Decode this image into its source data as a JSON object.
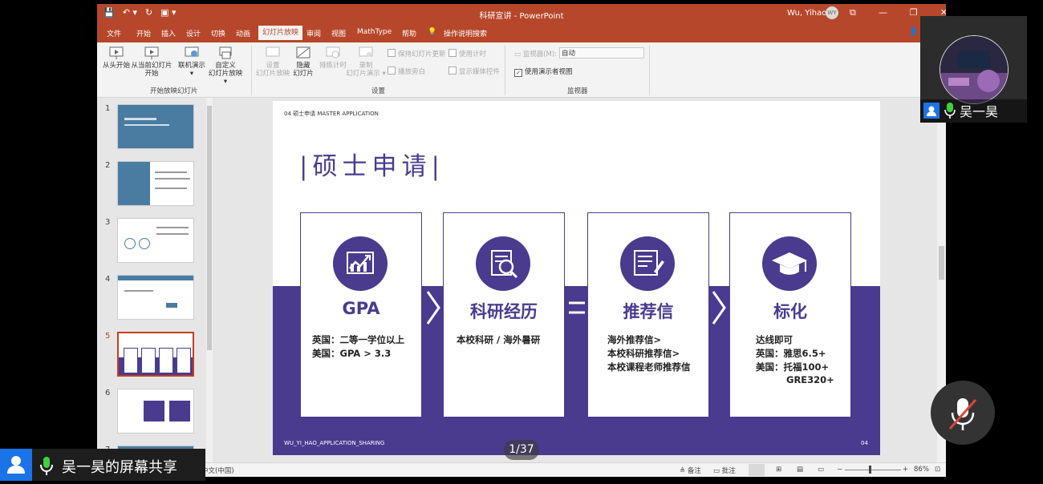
{
  "window": {
    "title": "科研宣讲 - PowerPoint",
    "user": "Wu, Yihao",
    "user_initials": "WY",
    "quick_access": [
      "💾",
      "↶ ▾",
      "↻",
      "▣ ▾"
    ],
    "controls": [
      "⧉",
      "—",
      "❐",
      "✕"
    ]
  },
  "tabs": [
    "文件",
    "开始",
    "插入",
    "设计",
    "切换",
    "动画",
    "幻灯片放映",
    "审阅",
    "视图",
    "MathType",
    "帮助",
    "操作说明搜索"
  ],
  "ribbon": {
    "start_group": {
      "label": "开始放映幻灯片",
      "from_start": "从头开始",
      "from_current_1": "从当前幻灯片",
      "from_current_2": "开始",
      "online_1": "联机演示",
      "online_2": "▾",
      "custom_1": "自定义",
      "custom_2": "幻灯片放映 ▾"
    },
    "setup_group": {
      "label": "设置",
      "setup_1": "设置",
      "setup_2": "幻灯片放映",
      "hide_1": "隐藏",
      "hide_2": "幻灯片",
      "rehearse": "排练计时",
      "record_1": "录制",
      "record_2": "幻灯片演示 ▾",
      "keep_updated": "保持幻灯片更新",
      "use_timings": "使用计时",
      "play_narration": "播放旁白",
      "show_media": "显示媒体控件"
    },
    "monitor_group": {
      "label": "监视器",
      "monitor_label": "监视器(M):",
      "monitor_value": "自动",
      "presenter_view": "使用演示者视图"
    }
  },
  "thumbnails": [
    {
      "num": "1",
      "selected": false
    },
    {
      "num": "2",
      "selected": false
    },
    {
      "num": "3",
      "selected": false
    },
    {
      "num": "4",
      "selected": false
    },
    {
      "num": "5",
      "selected": true
    },
    {
      "num": "6",
      "selected": false
    },
    {
      "num": "7",
      "selected": false
    }
  ],
  "slide": {
    "header": "04  硕士申请  MASTER APPLICATION",
    "title": "|硕士申请|",
    "cards": [
      {
        "title": "GPA",
        "lines": [
          "英国：二等一学位以上",
          "美国：GPA > 3.3"
        ],
        "icon": "chart-growth-icon"
      },
      {
        "title": "科研经历",
        "lines": [
          "本校科研 / 海外暑研"
        ],
        "icon": "research-magnifier-icon"
      },
      {
        "title": "推荐信",
        "lines": [
          "海外推荐信>",
          "本校科研推荐信>",
          "本校课程老师推荐信"
        ],
        "icon": "letter-pen-icon"
      },
      {
        "title": "标化",
        "lines": [
          "达线即可",
          "英国：雅思6.5+",
          "美国：托福100+",
          "GRE320+"
        ],
        "icon": "graduation-cap-icon"
      }
    ],
    "footer": "WU_YI_HAO_APPLICATION_SHARING",
    "page": "04"
  },
  "status": {
    "lang": "中文(中国)",
    "notes": "备注",
    "comments": "批注",
    "zoom": "86%"
  },
  "meeting": {
    "page_indicator": "1/37",
    "share_text": "吴一昊的屏幕共享",
    "participant": "吴一昊"
  },
  "colors": {
    "accent": "#4a3b8f",
    "ribbon": "#b7472a"
  }
}
